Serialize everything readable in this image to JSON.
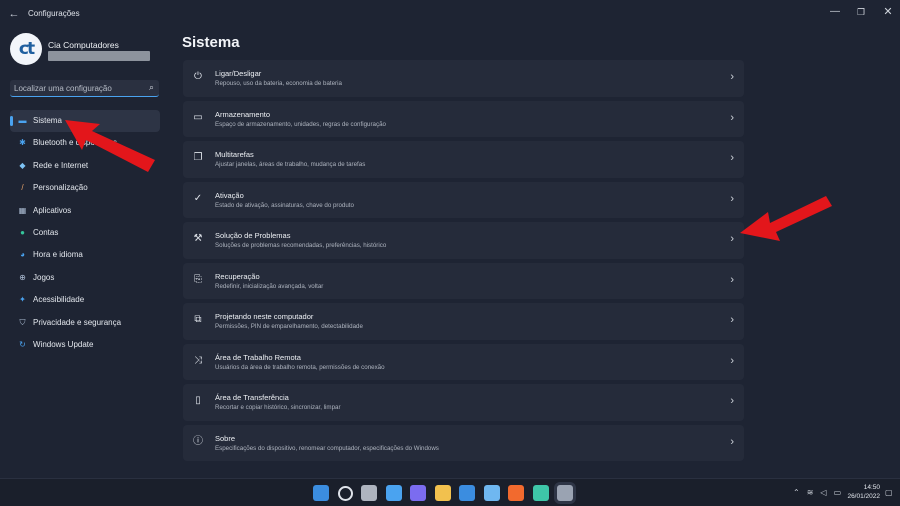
{
  "window": {
    "title": "Configurações",
    "back_icon": "back-arrow-icon"
  },
  "profile": {
    "initials": "ct",
    "name": "Cia Computadores"
  },
  "search": {
    "placeholder": "Localizar uma configuração"
  },
  "sidebar": {
    "items": [
      {
        "label": "Sistema",
        "icon": "monitor-icon",
        "color": "#4aa3f0",
        "glyph": "▬"
      },
      {
        "label": "Bluetooth e dispositivos",
        "icon": "bluetooth-icon",
        "color": "#4aa3f0",
        "glyph": "✱"
      },
      {
        "label": "Rede e Internet",
        "icon": "wifi-icon",
        "color": "#7ec3f5",
        "glyph": "◆"
      },
      {
        "label": "Personalização",
        "icon": "brush-icon",
        "color": "#e8a36a",
        "glyph": "/"
      },
      {
        "label": "Aplicativos",
        "icon": "apps-icon",
        "color": "#aebfd6",
        "glyph": "▦"
      },
      {
        "label": "Contas",
        "icon": "person-icon",
        "color": "#35c59b",
        "glyph": "●"
      },
      {
        "label": "Hora e idioma",
        "icon": "globe-clock-icon",
        "color": "#4aa3f0",
        "glyph": "◕"
      },
      {
        "label": "Jogos",
        "icon": "gamepad-icon",
        "color": "#aebfd6",
        "glyph": "⊕"
      },
      {
        "label": "Acessibilidade",
        "icon": "accessibility-icon",
        "color": "#4aa3f0",
        "glyph": "✦"
      },
      {
        "label": "Privacidade e segurança",
        "icon": "shield-icon",
        "color": "#aebfd6",
        "glyph": "⛉"
      },
      {
        "label": "Windows Update",
        "icon": "update-icon",
        "color": "#4aa3f0",
        "glyph": "↻"
      }
    ],
    "active_index": 0
  },
  "main": {
    "title": "Sistema",
    "cards": [
      {
        "title": "Ligar/Desligar",
        "desc": "Repouso, uso da bateria, economia de bateria",
        "icon": "power-icon",
        "glyph": "⏻"
      },
      {
        "title": "Armazenamento",
        "desc": "Espaço de armazenamento, unidades, regras de configuração",
        "icon": "storage-icon",
        "glyph": "▭"
      },
      {
        "title": "Multitarefas",
        "desc": "Ajustar janelas, áreas de trabalho, mudança de tarefas",
        "icon": "multitask-icon",
        "glyph": "❐"
      },
      {
        "title": "Ativação",
        "desc": "Estado de ativação, assinaturas, chave do produto",
        "icon": "check-circle-icon",
        "glyph": "✓"
      },
      {
        "title": "Solução de Problemas",
        "desc": "Soluções de problemas recomendadas, preferências, histórico",
        "icon": "wrench-icon",
        "glyph": "⚒"
      },
      {
        "title": "Recuperação",
        "desc": "Redefinir, inicialização avançada, voltar",
        "icon": "recovery-icon",
        "glyph": "⎘"
      },
      {
        "title": "Projetando neste computador",
        "desc": "Permissões, PIN de emparelhamento, detectabilidade",
        "icon": "projection-icon",
        "glyph": "⧉"
      },
      {
        "title": "Área de Trabalho Remota",
        "desc": "Usuários da área de trabalho remota, permissões de conexão",
        "icon": "remote-desktop-icon",
        "glyph": "⤨"
      },
      {
        "title": "Área de Transferência",
        "desc": "Recortar e copiar histórico, sincronizar, limpar",
        "icon": "clipboard-icon",
        "glyph": "▯"
      },
      {
        "title": "Sobre",
        "desc": "Especificações do dispositivo, renomear computador, especificações do Windows",
        "icon": "info-icon",
        "glyph": "ⓘ"
      }
    ]
  },
  "taskbar": {
    "apps": [
      {
        "icon": "start-icon",
        "color": "#3b8de0"
      },
      {
        "icon": "search-icon",
        "color": "#dfe3ea"
      },
      {
        "icon": "task-view-icon",
        "color": "#aeb4bf"
      },
      {
        "icon": "widgets-icon",
        "color": "#4aa3f0"
      },
      {
        "icon": "chat-icon",
        "color": "#7b6cf0"
      },
      {
        "icon": "file-explorer-icon",
        "color": "#f2c14e"
      },
      {
        "icon": "store-icon",
        "color": "#3b8de0"
      },
      {
        "icon": "notepad-icon",
        "color": "#6fb7f0"
      },
      {
        "icon": "brave-icon",
        "color": "#f26a2e"
      },
      {
        "icon": "edge-icon",
        "color": "#3ec6a8"
      },
      {
        "icon": "settings-icon",
        "color": "#9aa3b2"
      }
    ],
    "active_app": 10,
    "time": "14:50",
    "date": "26/01/2022"
  },
  "colors": {
    "accent": "#4aa3f0",
    "annotation_arrow": "#e3161b"
  }
}
